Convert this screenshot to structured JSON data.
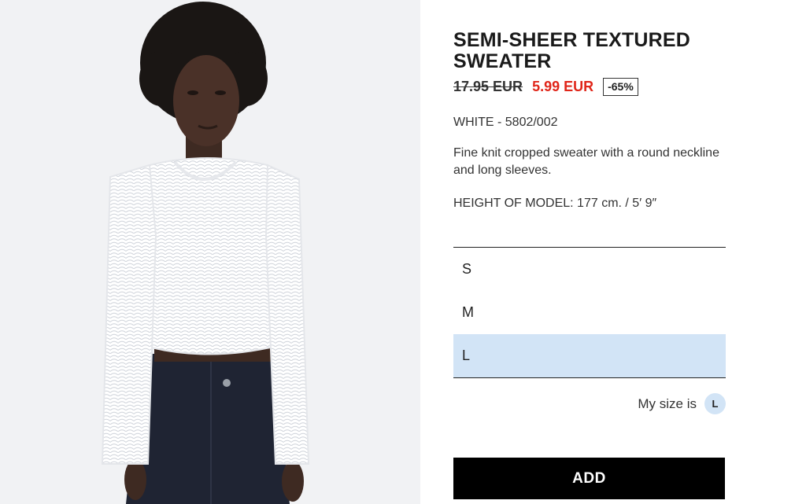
{
  "product": {
    "title": "SEMI-SHEER TEXTURED SWEATER",
    "old_price": "17.95 EUR",
    "new_price": "5.99 EUR",
    "discount": "-65%",
    "color_ref": "WHITE - 5802/002",
    "description": "Fine knit cropped sweater with a round neckline and long sleeves.",
    "model_height": "HEIGHT OF MODEL: 177 cm. / 5′ 9″",
    "image_subject": "model wearing white semi-sheer cropped sweater and dark jeans"
  },
  "sizes": [
    {
      "label": "S",
      "selected": false
    },
    {
      "label": "M",
      "selected": false
    },
    {
      "label": "L",
      "selected": true
    }
  ],
  "my_size": {
    "label": "My size is",
    "value": "L"
  },
  "add_button_label": "ADD",
  "colors": {
    "sale_red": "#e0261a",
    "selected_size_bg": "#d2e4f6",
    "button_black": "#000000"
  }
}
